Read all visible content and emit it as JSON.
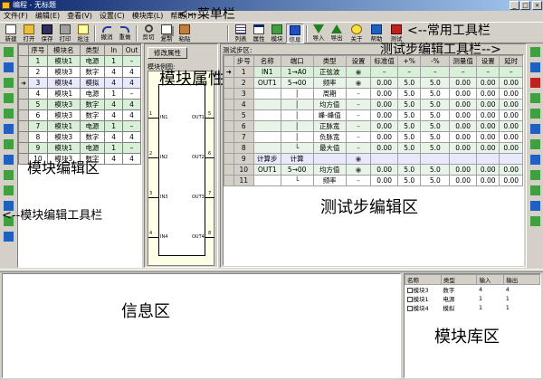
{
  "window": {
    "title": "编程 - 无标题",
    "min": "_",
    "max": "□",
    "close": "×"
  },
  "menu": [
    "文件(F)",
    "编辑(E)",
    "查看(V)",
    "设置(C)",
    "模块库(L)",
    "帮助(H)"
  ],
  "toolbar": {
    "left": [
      "新建",
      "打开",
      "保存",
      "打印",
      "批注",
      "撤消",
      "重做",
      "剪切",
      "复制",
      "粘贴"
    ],
    "right": [
      "列表",
      "属性",
      "模块",
      "信息",
      "导入",
      "导出",
      "关于",
      "帮助",
      "测试"
    ]
  },
  "colors": {
    "title_start": "#0a246a",
    "title_end": "#a6caf0",
    "row_green": "#d8f0d8",
    "row_lavender": "#e8e8ff",
    "row_yellow": "#ffffe0"
  },
  "callouts": {
    "menubar": "<--菜单栏",
    "toolbar": "<--常用工具栏",
    "step_toolbar": "测试步编辑工具栏-->",
    "module_props": "模块属性区",
    "module_edit": "模块编辑区",
    "module_toolbar": "<--模块编辑工具栏",
    "step_edit": "测试步编辑区",
    "info": "信息区",
    "library": "模块库区"
  },
  "module_table": {
    "headers": [
      "序号",
      "模块名",
      "类型",
      "In",
      "Out"
    ],
    "rows": [
      {
        "no": "1",
        "name": "模块1",
        "type": "电源",
        "in": "1",
        "out": "–"
      },
      {
        "no": "2",
        "name": "模块3",
        "type": "数字",
        "in": "4",
        "out": "4"
      },
      {
        "no": "3",
        "name": "模块4",
        "type": "模拟",
        "in": "4",
        "out": "4"
      },
      {
        "no": "4",
        "name": "模块1",
        "type": "电源",
        "in": "1",
        "out": "–"
      },
      {
        "no": "5",
        "name": "模块3",
        "type": "数字",
        "in": "4",
        "out": "4"
      },
      {
        "no": "6",
        "name": "模块3",
        "type": "数字",
        "in": "4",
        "out": "4"
      },
      {
        "no": "7",
        "name": "模块1",
        "type": "电源",
        "in": "1",
        "out": "–"
      },
      {
        "no": "8",
        "name": "模块3",
        "type": "数字",
        "in": "4",
        "out": "4"
      },
      {
        "no": "9",
        "name": "模块1",
        "type": "电源",
        "in": "1",
        "out": "–"
      },
      {
        "no": "10",
        "name": "模块3",
        "type": "数字",
        "in": "4",
        "out": "4"
      }
    ]
  },
  "props": {
    "button": "修改属性",
    "label": "模块例图:",
    "pins_in": [
      "IN1",
      "IN2",
      "IN3",
      "IN4"
    ],
    "pins_out": [
      "OUT1",
      "OUT2",
      "OUT3",
      "OUT4"
    ],
    "pin_nums_in": [
      "1",
      "2",
      "3",
      "4"
    ],
    "pin_nums_out": [
      "5",
      "6",
      "7",
      "8"
    ]
  },
  "step_area": {
    "label": "测试步区:",
    "headers": [
      "步号",
      "名称",
      "端口",
      "类型",
      "设置",
      "标准值",
      "+%",
      "-%",
      "测量值",
      "设置",
      "延时"
    ],
    "rows": [
      {
        "step": "1",
        "name": "IN1",
        "port": "1→A0",
        "type": "正弦波",
        "set": "◉",
        "std": "–",
        "plus": "–",
        "minus": "–",
        "meas": "–",
        "set2": "–",
        "delay": "–"
      },
      {
        "step": "2",
        "name": "OUT1",
        "port": "5→00",
        "type": "频率",
        "set": "◉",
        "std": "0.00",
        "plus": "5.0",
        "minus": "5.0",
        "meas": "0.00",
        "set2": "0.00",
        "delay": "0.00"
      },
      {
        "step": "3",
        "name": "",
        "port": "│",
        "type": "周期",
        "set": "–",
        "std": "0.00",
        "plus": "5.0",
        "minus": "5.0",
        "meas": "0.00",
        "set2": "0.00",
        "delay": "0.00"
      },
      {
        "step": "4",
        "name": "",
        "port": "│",
        "type": "均方值",
        "set": "–",
        "std": "0.00",
        "plus": "5.0",
        "minus": "5.0",
        "meas": "0.00",
        "set2": "0.00",
        "delay": "0.00"
      },
      {
        "step": "5",
        "name": "",
        "port": "│",
        "type": "峰-峰值",
        "set": "–",
        "std": "0.00",
        "plus": "5.0",
        "minus": "5.0",
        "meas": "0.00",
        "set2": "0.00",
        "delay": "0.00"
      },
      {
        "step": "6",
        "name": "",
        "port": "│",
        "type": "正脉宽",
        "set": "–",
        "std": "0.00",
        "plus": "5.0",
        "minus": "5.0",
        "meas": "0.00",
        "set2": "0.00",
        "delay": "0.00"
      },
      {
        "step": "7",
        "name": "",
        "port": "│",
        "type": "负脉宽",
        "set": "–",
        "std": "0.00",
        "plus": "5.0",
        "minus": "5.0",
        "meas": "0.00",
        "set2": "0.00",
        "delay": "0.00"
      },
      {
        "step": "8",
        "name": "",
        "port": "└",
        "type": "最大值",
        "set": "–",
        "std": "0.00",
        "plus": "5.0",
        "minus": "5.0",
        "meas": "0.00",
        "set2": "0.00",
        "delay": "0.00"
      },
      {
        "step": "9",
        "name": "计算步",
        "port": "计算",
        "type": "",
        "set": "◉",
        "std": "",
        "plus": "",
        "minus": "",
        "meas": "",
        "set2": "",
        "delay": ""
      },
      {
        "step": "10",
        "name": "OUT1",
        "port": "5→00",
        "type": "均方值",
        "set": "◉",
        "std": "0.00",
        "plus": "5.0",
        "minus": "5.0",
        "meas": "0.00",
        "set2": "0.00",
        "delay": "0.00"
      },
      {
        "step": "11",
        "name": "",
        "port": "└",
        "type": "频率",
        "set": "–",
        "std": "0.00",
        "plus": "5.0",
        "minus": "5.0",
        "meas": "0.00",
        "set2": "0.00",
        "delay": "0.00"
      }
    ]
  },
  "library": {
    "headers": [
      "名称",
      "类型",
      "输入",
      "输出"
    ],
    "rows": [
      {
        "name": "模块3",
        "type": "数字",
        "in": "4",
        "out": "4"
      },
      {
        "name": "模块1",
        "type": "电源",
        "in": "1",
        "out": "1"
      },
      {
        "name": "模块4",
        "type": "模拟",
        "in": "1",
        "out": "1"
      }
    ]
  }
}
